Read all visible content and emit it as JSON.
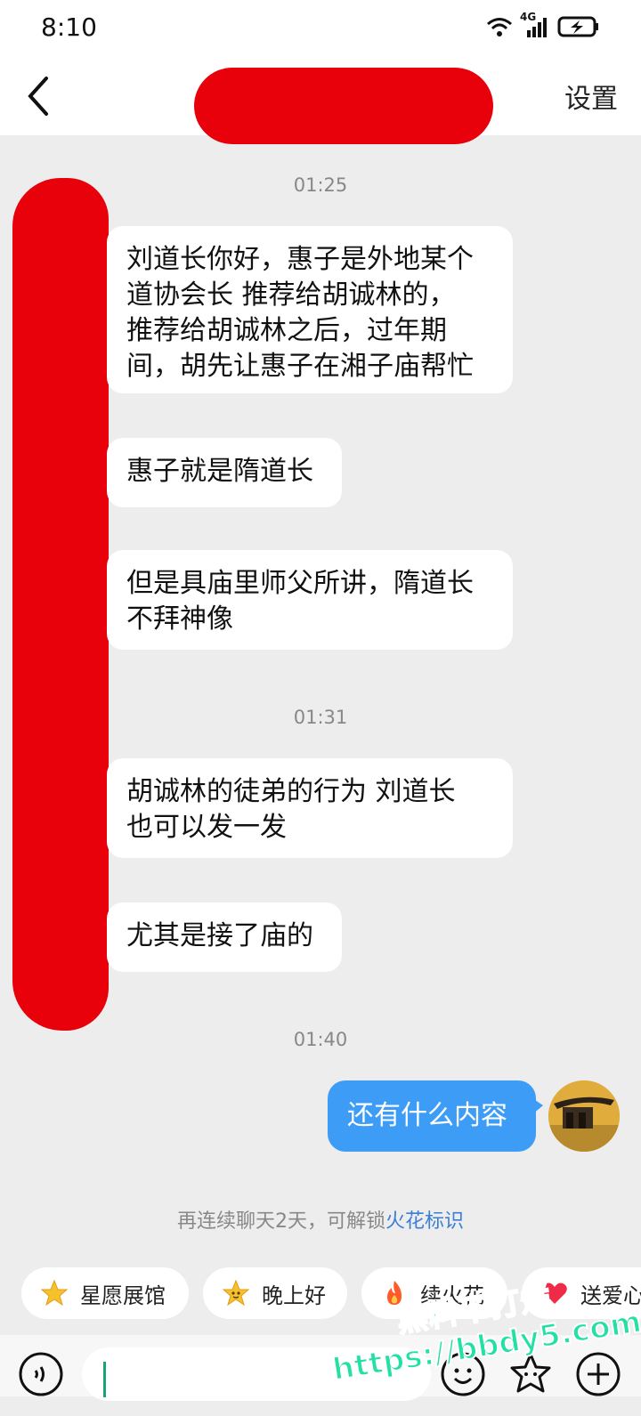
{
  "status": {
    "time": "8:10",
    "network": "4G"
  },
  "header": {
    "settings_label": "设置"
  },
  "timestamps": [
    "01:25",
    "01:31",
    "01:40"
  ],
  "incoming_messages": [
    {
      "lines": [
        "刘道长你好，惠子是外地某个",
        "道协会长 推荐给胡诚林的，",
        "推荐给胡诚林之后，过年期",
        "间，胡先让惠子在湘子庙帮忙"
      ]
    },
    {
      "lines": [
        "惠子就是隋道长"
      ]
    },
    {
      "lines": [
        "但是具庙里师父所讲，隋道长",
        "不拜神像"
      ]
    },
    {
      "lines": [
        "胡诚林的徒弟的行为 刘道长",
        "也可以发一发"
      ]
    },
    {
      "lines": [
        "尤其是接了庙的"
      ]
    }
  ],
  "outgoing_message": "还有什么内容",
  "hint": {
    "text": "再连续聊天2天，可解锁",
    "link": "火花标识"
  },
  "quick_replies": [
    {
      "label": "星愿展馆",
      "icon": "star-icon"
    },
    {
      "label": "晚上好",
      "icon": "star-face-icon"
    },
    {
      "label": "续火花",
      "icon": "fire-icon"
    },
    {
      "label": "送爱心",
      "icon": "heart-icon"
    }
  ],
  "watermark": {
    "line1": "黑料不打烊",
    "line2": "https://bbdy5.com"
  },
  "colors": {
    "accent": "#3d9cf5",
    "redaction": "#e8000b",
    "link": "#3a7fd5",
    "watermark": "#23e0a4"
  }
}
